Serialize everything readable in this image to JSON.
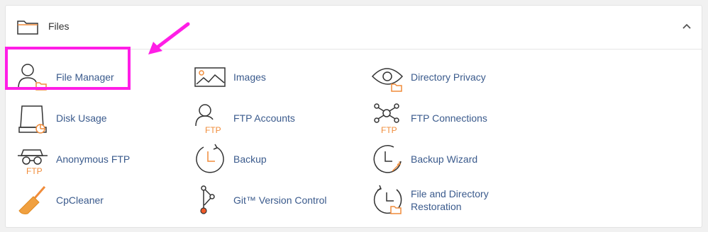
{
  "section": {
    "title": "Files",
    "header_icon": "folder-icon",
    "collapse_icon": "chevron-up-icon"
  },
  "items": [
    {
      "label": "File Manager",
      "icon": "file-manager-icon"
    },
    {
      "label": "Images",
      "icon": "images-icon"
    },
    {
      "label": "Directory Privacy",
      "icon": "directory-privacy-icon"
    },
    {
      "label": "Disk Usage",
      "icon": "disk-usage-icon"
    },
    {
      "label": "FTP Accounts",
      "icon": "ftp-accounts-icon"
    },
    {
      "label": "FTP Connections",
      "icon": "ftp-connections-icon"
    },
    {
      "label": "Anonymous FTP",
      "icon": "anonymous-ftp-icon"
    },
    {
      "label": "Backup",
      "icon": "backup-icon"
    },
    {
      "label": "Backup Wizard",
      "icon": "backup-wizard-icon"
    },
    {
      "label": "CpCleaner",
      "icon": "cpcleaner-icon"
    },
    {
      "label": "Git™ Version Control",
      "icon": "git-version-control-icon"
    },
    {
      "label": "File and Directory Restoration",
      "icon": "file-directory-restoration-icon"
    }
  ],
  "icon_glyphs": {
    "ftp": "FTP"
  },
  "colors": {
    "highlight": "#ff1ee6",
    "link": "#3a5a8c",
    "accent": "#f08c3a"
  }
}
